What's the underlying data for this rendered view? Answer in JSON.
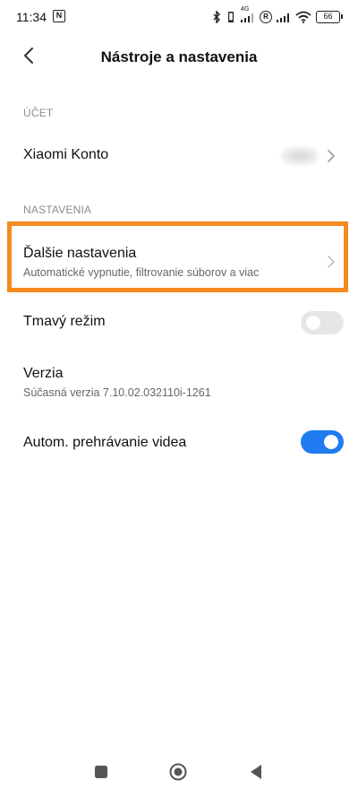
{
  "status_bar": {
    "time": "11:34",
    "nfc_label": "N",
    "network_label": "4G",
    "roaming_label": "R",
    "battery_level": "66"
  },
  "header": {
    "title": "Nástroje a nastavenia"
  },
  "sections": {
    "account": {
      "header": "ÚČET",
      "items": [
        {
          "label": "Xiaomi Konto"
        }
      ]
    },
    "settings": {
      "header": "NASTAVENIA",
      "items": [
        {
          "label": "Ďalšie nastavenia",
          "subtitle": "Automatické vypnutie, filtrovanie súborov a viac"
        },
        {
          "label": "Tmavý režim",
          "toggle_on": false
        },
        {
          "label": "Verzia",
          "subtitle": "Súčasná verzia 7.10.02.032110i-1261"
        },
        {
          "label": "Autom. prehrávanie videa",
          "toggle_on": true
        }
      ]
    }
  },
  "colors": {
    "highlight": "#f58a1f",
    "toggle_on": "#1e7cf0",
    "toggle_off": "#e6e6e6"
  },
  "icons": {
    "back": "back-arrow-icon",
    "chevron": "chevron-right-icon",
    "nav_recents": "square-icon",
    "nav_home": "circle-icon",
    "nav_back": "triangle-icon"
  }
}
